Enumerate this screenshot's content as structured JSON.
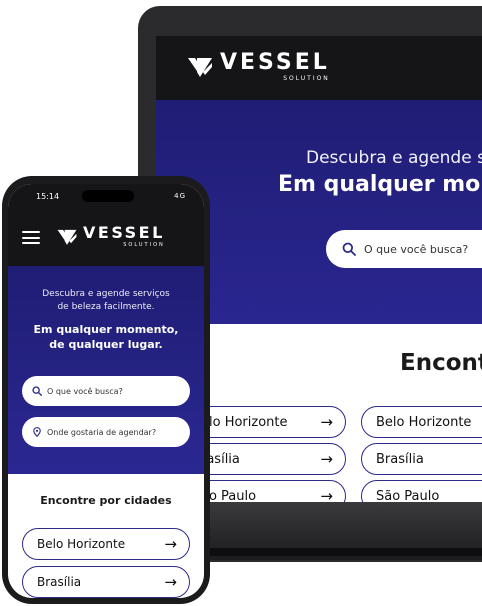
{
  "brand": {
    "name": "VESSEL",
    "tagline": "SOLUTION"
  },
  "colors": {
    "hero": "#2a2690",
    "header": "#151517",
    "pill_border": "#2d2a8a"
  },
  "laptop": {
    "hero_subtitle": "Descubra e agende s",
    "hero_title": "Em qualquer mom",
    "search_placeholder": "O que você busca?",
    "section_title": "Encont",
    "cities_col1": [
      "elo Horizonte",
      "rasília",
      "ão Paulo"
    ],
    "cities_col2": [
      "Belo Horizonte",
      "Brasília",
      "São Paulo"
    ]
  },
  "phone": {
    "status_time": "15:14",
    "status_signal": "4G",
    "hero_subtitle_line1": "Descubra e agende serviços",
    "hero_subtitle_line2": "de beleza facilmente.",
    "hero_title_line1": "Em qualquer momento,",
    "hero_title_line2": "de qualquer lugar.",
    "search_placeholder": "O que você busca?",
    "location_placeholder": "Onde gostaria de agendar?",
    "section_title": "Encontre por cidades",
    "cities": [
      "Belo Horizonte",
      "Brasília"
    ]
  },
  "icons": {
    "search": "search-icon",
    "location": "location-pin-icon",
    "arrow": "arrow-right-icon",
    "menu": "menu-icon"
  }
}
